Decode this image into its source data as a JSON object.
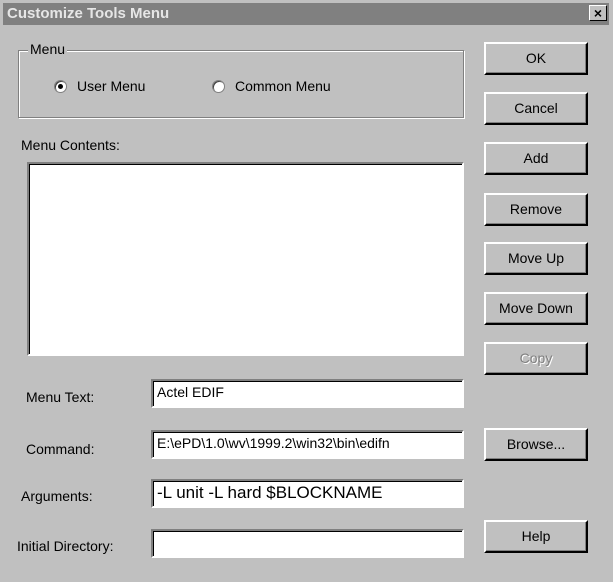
{
  "window": {
    "title": "Customize Tools Menu",
    "close_glyph": "×"
  },
  "menu_group": {
    "label": "Menu",
    "options": [
      {
        "label": "User Menu",
        "selected": true
      },
      {
        "label": "Common Menu",
        "selected": false
      }
    ]
  },
  "contents": {
    "label": "Menu Contents:"
  },
  "fields": {
    "menu_text": {
      "label": "Menu Text:",
      "value": "Actel EDIF"
    },
    "command": {
      "label": "Command:",
      "value": "E:\\ePD\\1.0\\wv\\1999.2\\win32\\bin\\edifn"
    },
    "arguments": {
      "label": "Arguments:",
      "value": "-L unit -L hard $BLOCKNAME"
    },
    "initial_directory": {
      "label": "Initial Directory:",
      "value": ""
    }
  },
  "buttons": {
    "ok": "OK",
    "cancel": "Cancel",
    "add": "Add",
    "remove": "Remove",
    "move_up": "Move Up",
    "move_down": "Move Down",
    "copy": "Copy",
    "browse": "Browse...",
    "help": "Help"
  }
}
